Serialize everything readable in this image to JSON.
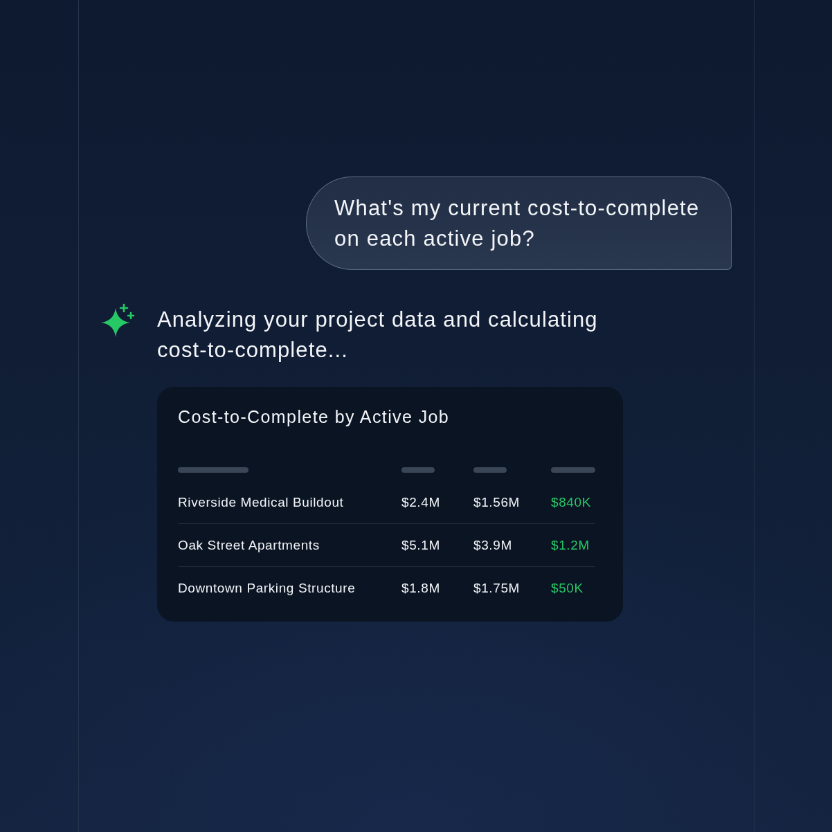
{
  "user_message": {
    "text": "What's my current cost-to-complete on each active job?"
  },
  "assistant": {
    "status": "Analyzing your project data and calculating cost-to-complete..."
  },
  "table_card": {
    "title": "Cost-to-Complete by Active Job",
    "rows": [
      {
        "column_1": "Riverside Medical Buildout",
        "column_2": "$2.4M",
        "column_3": "$1.56M",
        "column_4": "$840K"
      },
      {
        "column_1": "Oak Street Apartments",
        "column_2": "$5.1M",
        "column_3": "$3.9M",
        "column_4": "$1.2M"
      },
      {
        "column_1": "Downtown Parking Structure",
        "column_2": "$1.8M",
        "column_3": "$1.75M",
        "column_4": "$50K"
      }
    ]
  }
}
